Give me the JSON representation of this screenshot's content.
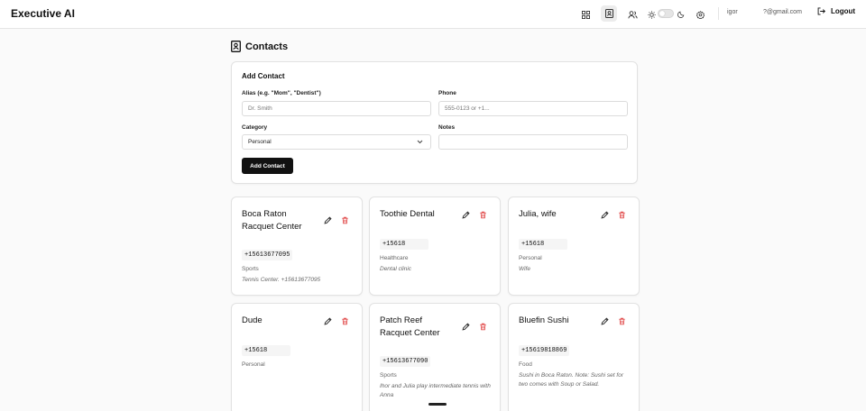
{
  "app": {
    "brand": "Executive AI"
  },
  "header": {
    "user_name": "igor",
    "user_email": "?@gmail.com",
    "logout_label": "Logout"
  },
  "page": {
    "title": "Contacts"
  },
  "form": {
    "title": "Add Contact",
    "alias_label": "Alias (e.g. \"Mom\", \"Dentist\")",
    "alias_placeholder": "Dr. Smith",
    "phone_label": "Phone",
    "phone_placeholder": "555-0123 or +1...",
    "category_label": "Category",
    "category_value": "Personal",
    "notes_label": "Notes",
    "notes_value": "",
    "submit_label": "Add Contact"
  },
  "contacts": [
    {
      "name": "Boca Raton Racquet Center",
      "phone": "+15613677095",
      "category": "Sports",
      "notes": "Tennis Center. +15613677095"
    },
    {
      "name": "Toothie Dental",
      "phone": "+15618",
      "category": "Healthcare",
      "notes": "Dental clinic"
    },
    {
      "name": "Julia, wife",
      "phone": "+15618",
      "category": "Personal",
      "notes": "Wife"
    },
    {
      "name": "Dude",
      "phone": "+15618",
      "category": "Personal",
      "notes": ""
    },
    {
      "name": "Patch Reef Racquet Center",
      "phone": "+15613677090",
      "category": "Sports",
      "notes": "Ihor and Julia play intermediate tennis with Anna"
    },
    {
      "name": "Bluefin Sushi",
      "phone": "+15619818869",
      "category": "Food",
      "notes": "Sushi in Boca Raton. Note: Sushi set for two comes with Soup or Salad."
    }
  ],
  "colors": {
    "danger": "#e04545",
    "primary": "#111111"
  }
}
